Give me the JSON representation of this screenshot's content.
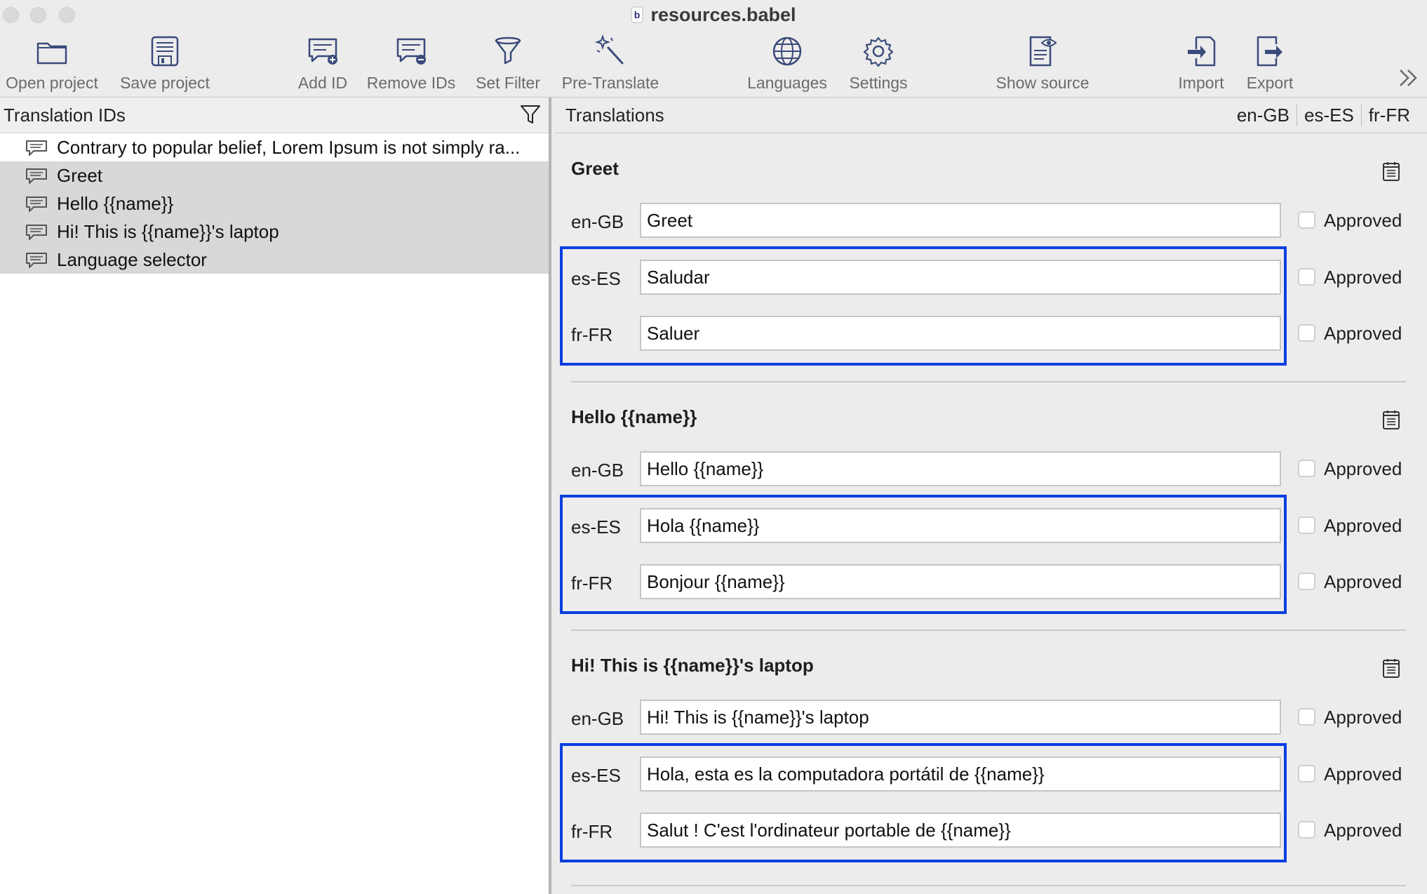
{
  "window": {
    "title": "resources.babel"
  },
  "toolbar": {
    "buttons": [
      {
        "label": "Open project",
        "icon": "folder-icon"
      },
      {
        "label": "Save project",
        "icon": "save-icon"
      },
      {
        "label": "Add ID",
        "icon": "add-id-icon"
      },
      {
        "label": "Remove IDs",
        "icon": "remove-ids-icon"
      },
      {
        "label": "Set Filter",
        "icon": "filter-icon"
      },
      {
        "label": "Pre-Translate",
        "icon": "magic-wand-icon"
      },
      {
        "label": "Languages",
        "icon": "globe-icon"
      },
      {
        "label": "Settings",
        "icon": "gear-icon"
      },
      {
        "label": "Show source",
        "icon": "show-source-icon"
      },
      {
        "label": "Import",
        "icon": "import-icon"
      },
      {
        "label": "Export",
        "icon": "export-icon"
      }
    ],
    "overflow_icon": "chevron-double-right-icon"
  },
  "left_pane": {
    "header": "Translation IDs",
    "items": [
      {
        "label": "Contrary to popular belief, Lorem Ipsum is not simply ra...",
        "selected": false
      },
      {
        "label": "Greet",
        "selected": true
      },
      {
        "label": "Hello {{name}}",
        "selected": true
      },
      {
        "label": "Hi! This is {{name}}'s laptop",
        "selected": true
      },
      {
        "label": "Language selector",
        "selected": true
      }
    ]
  },
  "right_pane": {
    "header": "Translations",
    "language_tabs": [
      "en-GB",
      "es-ES",
      "fr-FR"
    ],
    "approved_label": "Approved",
    "highlight_color": "#0a3fe0",
    "sections": [
      {
        "title": "Greet",
        "rows": [
          {
            "lang": "en-GB",
            "value": "Greet",
            "approved": false
          },
          {
            "lang": "es-ES",
            "value": "Saludar",
            "approved": false
          },
          {
            "lang": "fr-FR",
            "value": "Saluer",
            "approved": false
          }
        ]
      },
      {
        "title": "Hello {{name}}",
        "rows": [
          {
            "lang": "en-GB",
            "value": "Hello {{name}}",
            "approved": false
          },
          {
            "lang": "es-ES",
            "value": "Hola {{name}}",
            "approved": false
          },
          {
            "lang": "fr-FR",
            "value": "Bonjour {{name}}",
            "approved": false
          }
        ]
      },
      {
        "title": "Hi! This is {{name}}'s laptop",
        "rows": [
          {
            "lang": "en-GB",
            "value": "Hi! This is {{name}}'s laptop",
            "approved": false
          },
          {
            "lang": "es-ES",
            "value": "Hola, esta es la computadora portátil de {{name}}",
            "approved": false
          },
          {
            "lang": "fr-FR",
            "value": "Salut ! C'est l'ordinateur portable de {{name}}",
            "approved": false
          }
        ]
      }
    ]
  }
}
